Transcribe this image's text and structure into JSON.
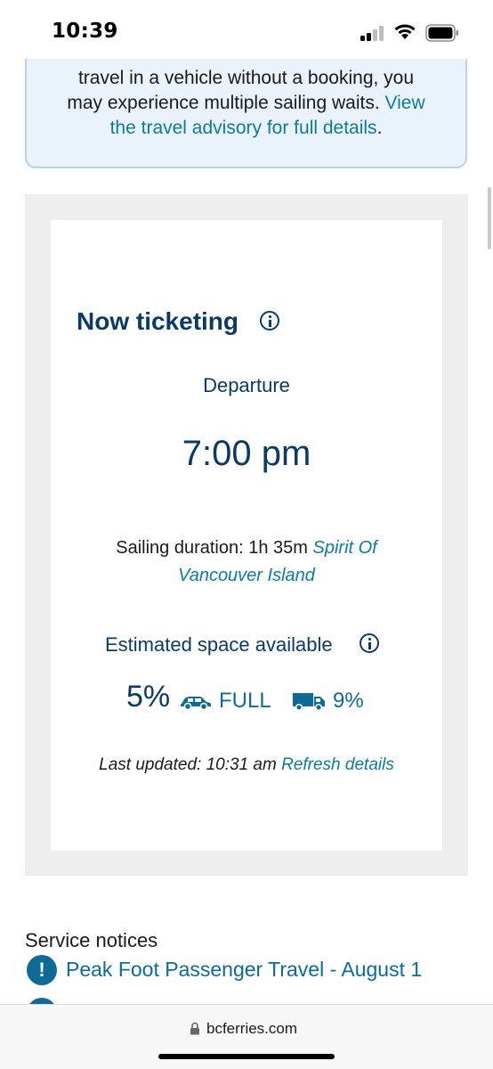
{
  "status_bar": {
    "time": "10:39"
  },
  "advisory": {
    "line1": "travel in a vehicle without a booking, you",
    "line2_text": "may experience multiple sailing waits. ",
    "line2_link": "View",
    "line3_link": "the travel advisory for full details",
    "line3_end": "."
  },
  "sailing": {
    "status_title": "Now ticketing",
    "departure_label": "Departure",
    "departure_time": "7:00 pm",
    "duration_text": "Sailing duration: 1h 35m ",
    "vessel_line1": "Spirit Of",
    "vessel_line2": "Vancouver Island",
    "space_label": "Estimated space available",
    "space_percent": "5%",
    "car_status": "FULL",
    "truck_percent": "9%",
    "last_updated": "Last updated: 10:31 am ",
    "refresh_link": "Refresh details"
  },
  "notices": {
    "title": "Service notices",
    "items": [
      {
        "label": "Peak Foot Passenger Travel - August 1",
        "icon": "alert-icon"
      }
    ]
  },
  "browser": {
    "url": "bcferries.com"
  },
  "colors": {
    "navy": "#0b3a66",
    "link": "#0f7a9c",
    "advisory_bg": "#eaf2fb",
    "card_bg": "#eeeeee"
  }
}
